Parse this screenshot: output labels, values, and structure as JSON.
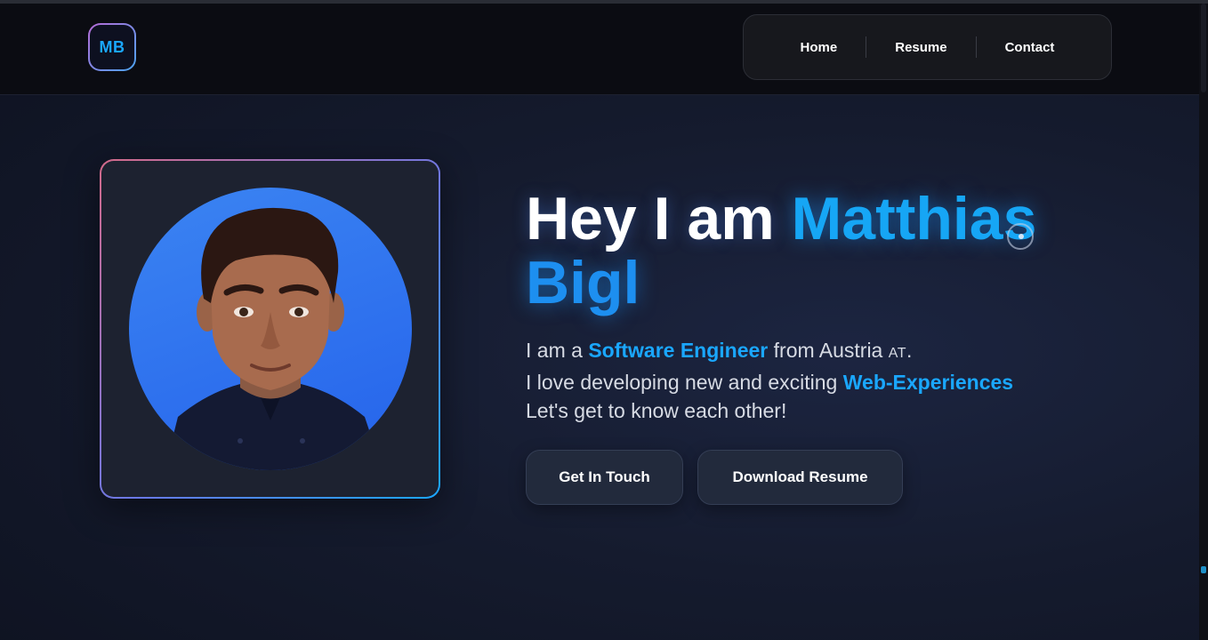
{
  "header": {
    "logo_text": "MB",
    "nav": [
      {
        "label": "Home"
      },
      {
        "label": "Resume"
      },
      {
        "label": "Contact"
      }
    ]
  },
  "hero": {
    "title_prefix": "Hey I am ",
    "first_name": "Matthias",
    "last_name": "Bigl",
    "intro": {
      "line1_prefix": "I am a ",
      "line1_highlight": "Software Engineer",
      "line1_suffix": " from Austria ",
      "flag": "AT",
      "line1_end": ".",
      "line2_prefix": "I love developing new and exciting ",
      "line2_highlight": "Web-Experiences",
      "line3": "Let's get to know each other!"
    },
    "buttons": {
      "get_in_touch": "Get In Touch",
      "download_resume": "Download Resume"
    }
  },
  "colors": {
    "accent": "#1aa7ff",
    "background": "#151b2e",
    "avatar_bg": "#2f74ee"
  }
}
